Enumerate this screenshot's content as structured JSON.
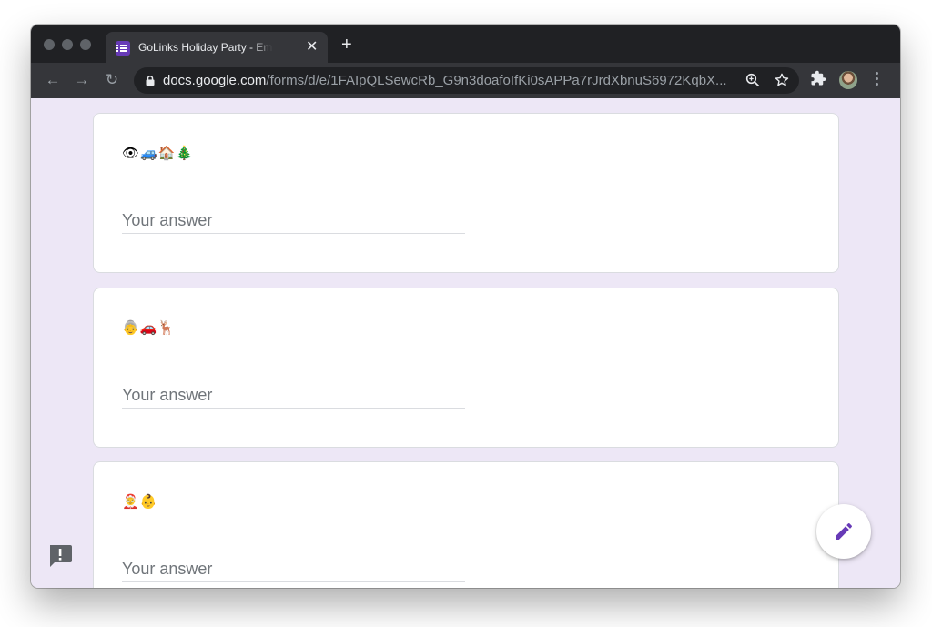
{
  "browser": {
    "tab_title": "GoLinks Holiday Party - Emoji Form",
    "tab_close": "✕",
    "new_tab": "+",
    "back": "←",
    "forward": "→",
    "reload": "↻",
    "url_host": "docs.google.com",
    "url_path": "/forms/d/e/1FAIpQLSewcRb_G9n3doafoIfKi0sAPPa7rJrdXbnuS6972KqbX...",
    "icons": [
      "back-arrow-icon",
      "forward-arrow-icon",
      "reload-icon",
      "lock-icon",
      "zoom-icon",
      "star-icon",
      "extensions-icon",
      "profile-avatar",
      "menu-icon"
    ]
  },
  "form": {
    "questions": [
      {
        "emoji": "👁🚙🏠🎄",
        "answer_placeholder": "Your answer",
        "answer_value": ""
      },
      {
        "emoji": "👵🚗🦌",
        "answer_placeholder": "Your answer",
        "answer_value": ""
      },
      {
        "emoji": "🤶👶",
        "answer_placeholder": "Your answer",
        "answer_value": ""
      }
    ]
  },
  "floating": {
    "report_icon": "report-icon",
    "edit_icon": "pencil-icon"
  },
  "colors": {
    "page_background": "#ede7f6",
    "accent": "#673ab7",
    "card_background": "#ffffff"
  }
}
